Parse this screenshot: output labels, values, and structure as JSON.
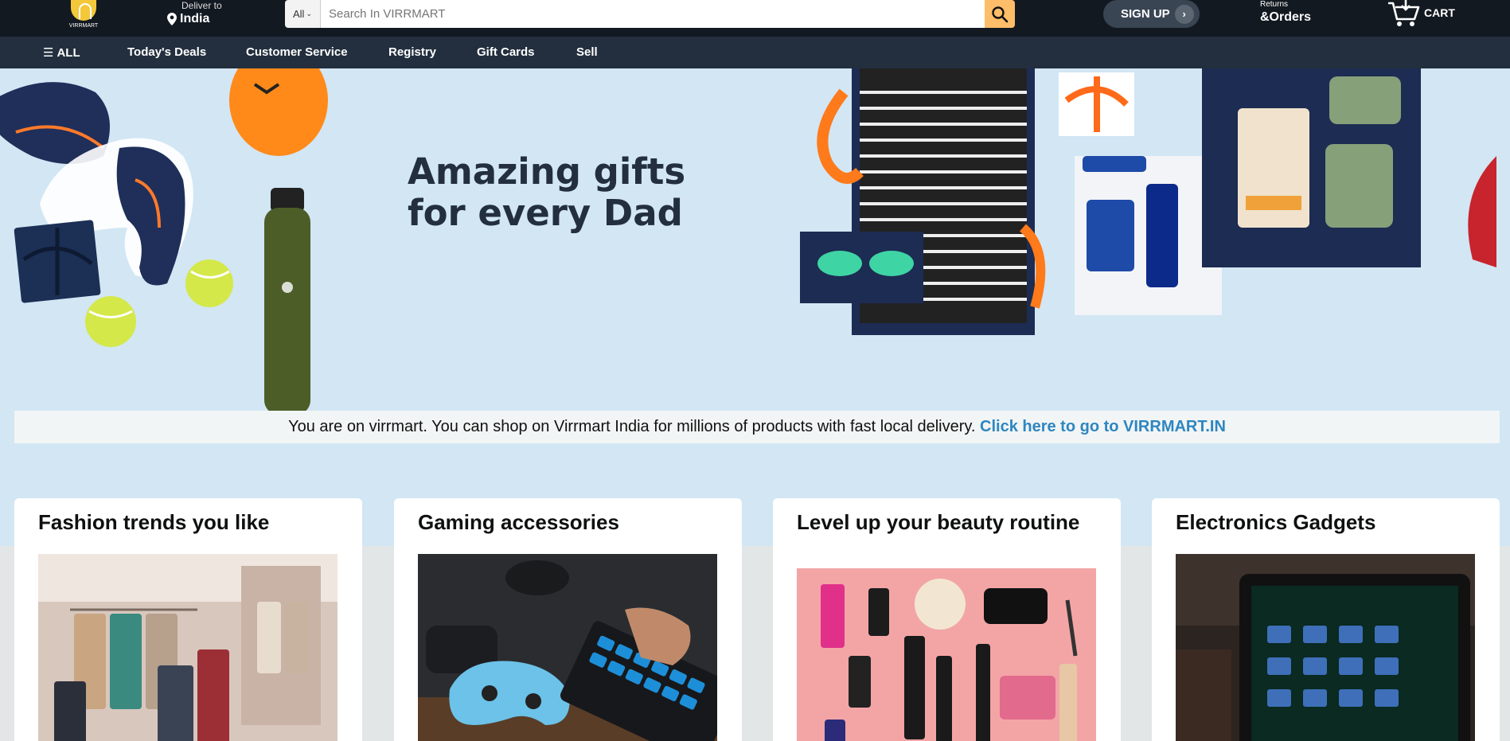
{
  "header": {
    "logo_text": "VIRRMART",
    "deliver_label": "Deliver to",
    "deliver_location": "India",
    "search": {
      "category": "All",
      "placeholder": "Search In VIRRMART"
    },
    "signup_label": "SIGN UP",
    "returns_small": "Returns",
    "returns_big": "&Orders",
    "cart_label": "CART"
  },
  "nav": {
    "all_label": "ALL",
    "items": [
      "Today's Deals",
      "Customer Service",
      "Registry",
      "Gift Cards",
      "Sell"
    ]
  },
  "hero": {
    "title_line1": "Amazing gifts",
    "title_line2": "for every Dad"
  },
  "notice": {
    "text": "You are on virrmart. You can shop on Virrmart India for millions of products with fast local delivery.",
    "link_text": "Click here to go to VIRRMART.IN"
  },
  "cards": [
    {
      "title": "Fashion trends you like"
    },
    {
      "title": "Gaming accessories"
    },
    {
      "title": "Level up your beauty routine"
    },
    {
      "title": "Electronics Gadgets"
    }
  ],
  "colors": {
    "header_bg": "#131921",
    "nav_bg": "#232f3e",
    "search_button": "#febd69",
    "hero_bg": "#d2e6f4",
    "link": "#2e86c1"
  }
}
